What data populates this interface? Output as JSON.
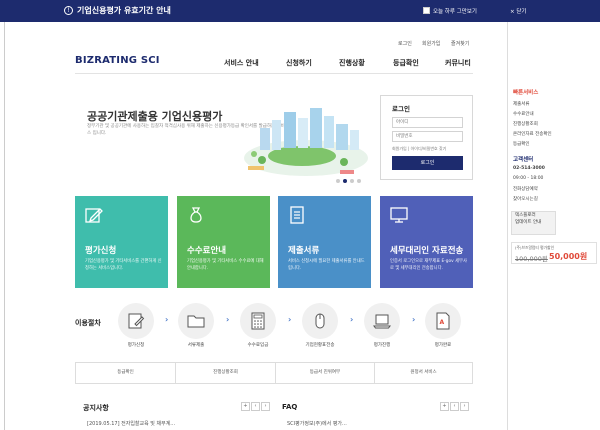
{
  "banner": {
    "title": "기업신용평가 유효기간 안내",
    "checkbox_label": "오늘 하루 그만보기",
    "close_label": "× 닫기"
  },
  "header": {
    "logo": "BIZRATING SCI",
    "util": [
      "로그인",
      "회원가입",
      "즐겨찾기"
    ],
    "nav": [
      "서비스 안내",
      "신청하기",
      "진행상황",
      "등급확인",
      "커뮤니티"
    ]
  },
  "hero": {
    "title": "공공기관제출용 기업신용평가",
    "desc": "정부기관 및 공공기관에 사용하는 입찰자 적격심사용 위해 제출하는 신용평가등급 확인서를 발급하는 서비스 입니다."
  },
  "login": {
    "title": "로그인",
    "id_placeholder": "아이디",
    "pw_placeholder": "비밀번호",
    "links": "회원가입 | 아이디/비밀번호 찾기",
    "button": "로그인"
  },
  "cards": [
    {
      "title": "평가신청",
      "desc": "기업신용평가 및 기타서비스를 간편하게 신청하는 서비스입니다.",
      "color": "#3fbdac",
      "icon": "pencil-icon"
    },
    {
      "title": "수수료안내",
      "desc": "기업신용평가 및 기타서비스 수수료에 대해 안내합니다.",
      "color": "#5bb85a",
      "icon": "money-bag-icon"
    },
    {
      "title": "제출서류",
      "desc": "서비스 신청시에 필요한 제출서류를 안내드립니다.",
      "color": "#4a90c8",
      "icon": "document-icon"
    },
    {
      "title": "세무대리인 자료전송",
      "desc": "인증서 로그인으로 재무제표 E-gov 세무사로 및 세무대리인 전송합니다.",
      "color": "#5060b8",
      "icon": "monitor-icon"
    }
  ],
  "procedure": {
    "title": "이용절차",
    "steps": [
      "평가신청",
      "서류제출",
      "수수료입금",
      "기업현황표전송",
      "평가진행",
      "평가완료"
    ]
  },
  "quick": [
    "등급확인",
    "진행상황조회",
    "등급서 진위여부",
    "원청서 서비스"
  ],
  "notice": {
    "title": "공지사항",
    "item": "[2019.05.17] 전자입찰교육 및 채무계..."
  },
  "faq": {
    "title": "FAQ",
    "item": "SCI평가정보(주)에서 평가..."
  },
  "side": {
    "quick_title": "빠른서비스",
    "quick_items": [
      "제출서류",
      "수수료안내",
      "진행상황조회",
      "온라인자료 전송확인",
      "등급확인"
    ],
    "cs_title": "고객센터",
    "cs_items": [
      "02-514-3000",
      "09:00 - 18:00",
      "전화상담예약",
      "찾아오시는길"
    ],
    "box": [
      "덱스플로러",
      "업데이트 안내"
    ],
    "price_label": "(주)브즈알럼티 평가할인",
    "price_old": "100,000원",
    "price_new": "50,000원"
  },
  "colors": {
    "brand": "#1d2b6e",
    "accent": "#e04a3a"
  }
}
